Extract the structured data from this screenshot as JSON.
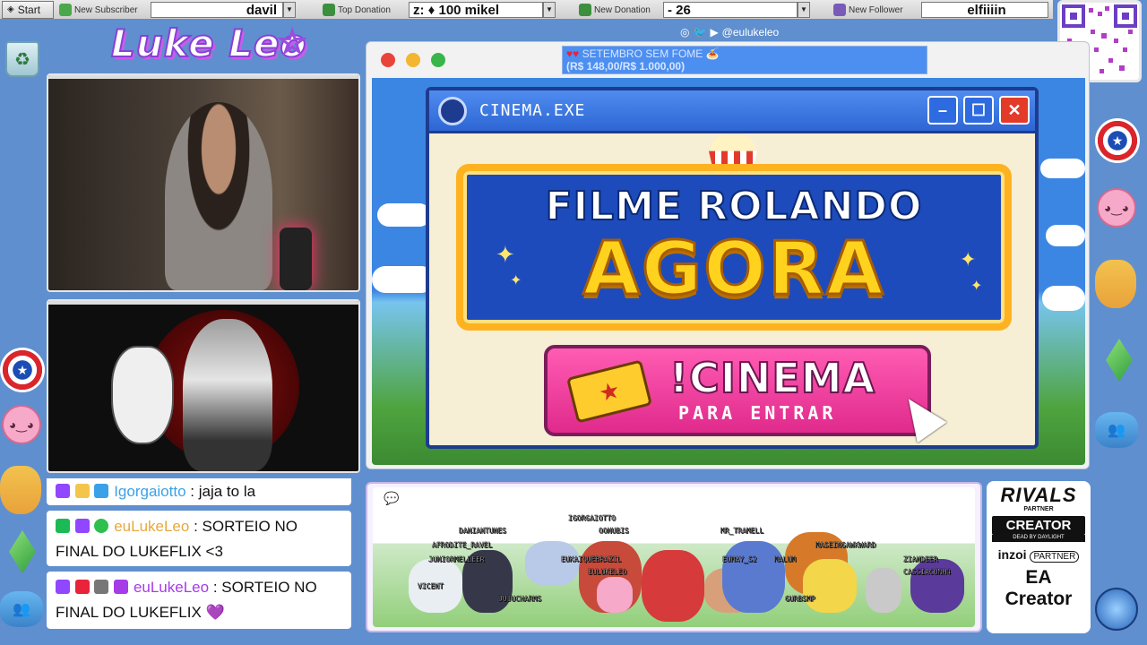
{
  "taskbar": {
    "start_label": "Start",
    "new_subscriber_label": "New Subscriber",
    "new_subscriber_value": "davil",
    "top_donation_label": "Top Donation",
    "top_donation_value": "z: ♦ 100   mikel",
    "new_donation_label": "New Donation",
    "new_donation_value": "- 26",
    "new_follower_label": "New Follower",
    "new_follower_value": "elfiiiin"
  },
  "branding": {
    "logo_text": "Luke Leo"
  },
  "main_window": {
    "goal_text": "SETEMBRO SEM FOME",
    "goal_progress": "(R$ 148,00/R$ 1.000,00)",
    "social_handle": "@eulukeleo"
  },
  "cinema": {
    "window_title": "CINEMA.EXE",
    "headline_1": "FILME ROLANDO",
    "headline_2": "AGORA",
    "command": "!CINEMA",
    "command_sub": "PARA ENTRAR",
    "minimize_label": "–",
    "maximize_label": "☐",
    "close_label": "✕"
  },
  "chat": {
    "messages": [
      {
        "user": "Igorgaiotto",
        "text": ": jaja to la"
      },
      {
        "user": "euLukeLeo",
        "text": ": SORTEIO NO FINAL DO LUKEFLIX <3"
      },
      {
        "user": "euLukeLeo",
        "text": ": SORTEIO NO FINAL DO LUKEFLIX",
        "emote": "💜"
      }
    ]
  },
  "pokemon": {
    "names": [
      "IGORGAIOTTO",
      "DANIANTUNES",
      "OONUBIS",
      "AFRODITE_RAVEL",
      "MR_TRAMELL",
      "JUNIORMELLEER",
      "EUKAIQUEBRAZIL",
      "EUMAY_S2",
      "MALUM",
      "MASEINGAWKWARD",
      "EULUKELEO",
      "ZIANDEER",
      "CASSIACUNH4",
      "VICENT",
      "JUJUCHARMS",
      "GURBSMP"
    ]
  },
  "sponsors": {
    "marvel_rivals": "RIVALS",
    "marvel_rivals_sub": "PARTNER",
    "creator": "CREATOR",
    "creator_sub": "DEAD BY DAYLIGHT",
    "inzoi": "inzoi",
    "inzoi_sub": "PARTNER",
    "ea": "EA Creator"
  }
}
